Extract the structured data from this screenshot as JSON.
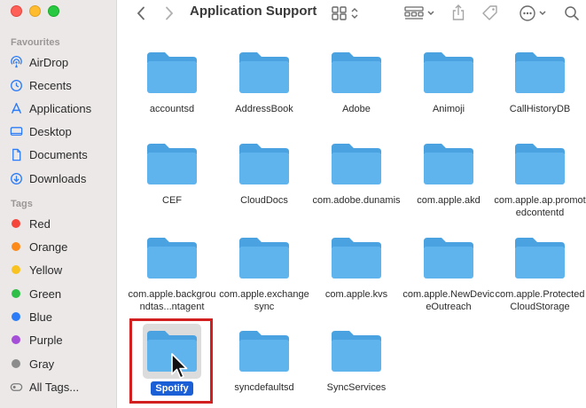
{
  "window": {
    "title": "Application Support"
  },
  "sidebar": {
    "favourites_title": "Favourites",
    "favourites": [
      {
        "label": "AirDrop",
        "icon": "airdrop-icon"
      },
      {
        "label": "Recents",
        "icon": "clock-icon"
      },
      {
        "label": "Applications",
        "icon": "applications-icon"
      },
      {
        "label": "Desktop",
        "icon": "desktop-icon"
      },
      {
        "label": "Documents",
        "icon": "document-icon"
      },
      {
        "label": "Downloads",
        "icon": "download-icon"
      }
    ],
    "tags_title": "Tags",
    "tags": [
      {
        "label": "Red",
        "color": "#f4463a"
      },
      {
        "label": "Orange",
        "color": "#fb8a1b"
      },
      {
        "label": "Yellow",
        "color": "#f8c321"
      },
      {
        "label": "Green",
        "color": "#2fbe47"
      },
      {
        "label": "Blue",
        "color": "#2b7cf6"
      },
      {
        "label": "Purple",
        "color": "#a54fd9"
      },
      {
        "label": "Gray",
        "color": "#8c8c8c"
      },
      {
        "label": "All Tags...",
        "icon": "all-tags-icon"
      }
    ]
  },
  "folders": [
    {
      "label": "accountsd"
    },
    {
      "label": "AddressBook"
    },
    {
      "label": "Adobe"
    },
    {
      "label": "Animoji"
    },
    {
      "label": "CallHistoryDB"
    },
    {
      "label": "CEF"
    },
    {
      "label": "CloudDocs"
    },
    {
      "label": "com.adobe.dunamis"
    },
    {
      "label": "com.apple.akd"
    },
    {
      "label": "com.apple.ap.promotedcontentd"
    },
    {
      "label": "com.apple.backgroundtas...ntagent"
    },
    {
      "label": "com.apple.exchangesync"
    },
    {
      "label": "com.apple.kvs"
    },
    {
      "label": "com.apple.NewDeviceOutreach"
    },
    {
      "label": "com.apple.ProtectedCloudStorage"
    },
    {
      "label": "Spotify",
      "selected": true
    },
    {
      "label": "syncdefaultsd"
    },
    {
      "label": "SyncServices"
    }
  ],
  "colors": {
    "folder": "#5fb4ee",
    "folder_tab": "#4aa3e0",
    "selection": "#1a5fd6",
    "highlight": "#d21f1f"
  }
}
